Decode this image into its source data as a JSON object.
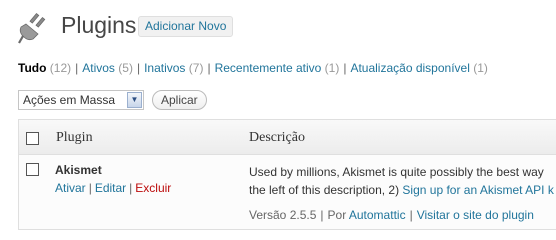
{
  "header": {
    "title": "Plugins",
    "add_new_label": "Adicionar Novo",
    "icon": "plugin-icon"
  },
  "filters": [
    {
      "label": "Tudo",
      "count": "(12)",
      "current": true
    },
    {
      "label": "Ativos",
      "count": "(5)",
      "current": false
    },
    {
      "label": "Inativos",
      "count": "(7)",
      "current": false
    },
    {
      "label": "Recentemente ativo",
      "count": "(1)",
      "current": false
    },
    {
      "label": "Atualização disponível",
      "count": "(1)",
      "current": false
    }
  ],
  "filter_separator": "|",
  "bulk": {
    "selected": "Ações em Massa",
    "apply_label": "Aplicar"
  },
  "table": {
    "columns": [
      "Plugin",
      "Descrição"
    ],
    "rows": [
      {
        "name": "Akismet",
        "actions": {
          "activate": "Ativar",
          "edit": "Editar",
          "delete": "Excluir"
        },
        "description_line1": "Used by millions, Akismet is quite possibly the best way",
        "description_line2_prefix": "the left of this description, 2)",
        "description_line2_link": "Sign up for an Akismet API k",
        "version": "Versão 2.5.5",
        "by_prefix": "Por",
        "author": "Automattic",
        "site_link": "Visitar o site do plugin"
      }
    ]
  },
  "colors": {
    "link": "#21759b",
    "danger": "#bc0b0b",
    "title": "#464646"
  }
}
